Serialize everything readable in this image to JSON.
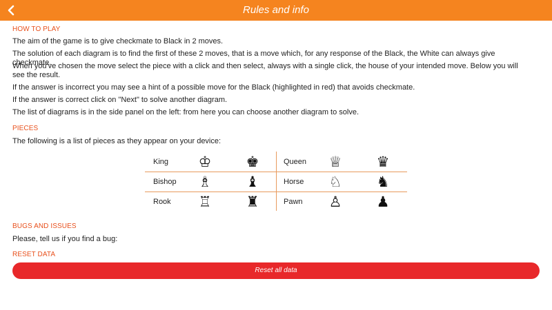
{
  "header": {
    "title": "Rules and info",
    "back_icon": "chevron-left-icon"
  },
  "how_to_play": {
    "title": "HOW TO PLAY",
    "paragraphs": [
      "The aim of the game is to give checkmate to Black in 2 moves.",
      "The solution of each diagram is to find the first of these 2 moves, that is a move which, for any response of the Black, the White can always give checkmate.",
      "When you've chosen the move select the piece with a click and then select, always with a single click, the house of your intended move. Below you will see the result.",
      "If the answer is incorrect you may see a hint of a possible move for the Black (highlighted in red) that avoids checkmate.",
      "If the answer is correct click on \"Next\" to solve another diagram.",
      "The list of diagrams is in the side panel on the left: from here you can choose another diagram to solve."
    ]
  },
  "pieces": {
    "title": "PIECES",
    "intro": "The following is a list of pieces as they appear on your device:",
    "rows": [
      {
        "left": {
          "name": "King",
          "white": "♔",
          "black": "♚"
        },
        "right": {
          "name": "Queen",
          "white": "♕",
          "black": "♛"
        }
      },
      {
        "left": {
          "name": "Bishop",
          "white": "♗",
          "black": "♝"
        },
        "right": {
          "name": "Horse",
          "white": "♘",
          "black": "♞"
        }
      },
      {
        "left": {
          "name": "Rook",
          "white": "♖",
          "black": "♜"
        },
        "right": {
          "name": "Pawn",
          "white": "♙",
          "black": "♟"
        }
      }
    ]
  },
  "bugs": {
    "title": "BUGS AND ISSUES",
    "text": "Please, tell us if you find a bug:"
  },
  "reset": {
    "title": "RESET DATA",
    "button_label": "Reset all data"
  },
  "colors": {
    "header_bg": "#f5841f",
    "section_title": "#e8501c",
    "reset_button": "#e8282a",
    "table_lines": "#e89a5c"
  }
}
